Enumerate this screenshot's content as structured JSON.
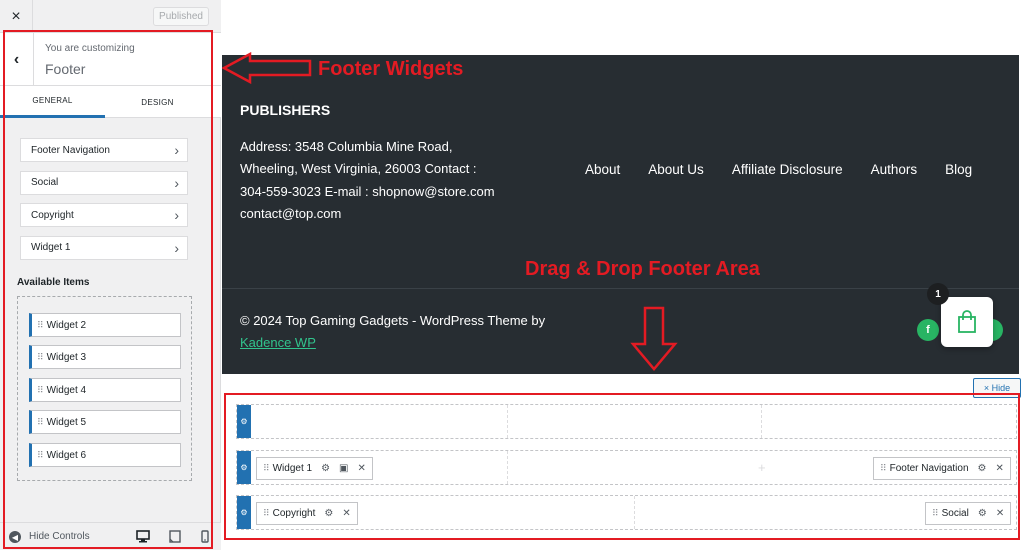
{
  "sidebar": {
    "close_glyph": "×",
    "published_label": "Published",
    "back_glyph": "‹",
    "customizing_label": "You are customizing",
    "section_title": "Footer",
    "tabs": [
      {
        "label": "GENERAL",
        "active": true
      },
      {
        "label": "DESIGN",
        "active": false
      }
    ],
    "nav_items": [
      "Footer Navigation",
      "Social",
      "Copyright",
      "Widget 1"
    ],
    "chevron_glyph": "›",
    "available_label": "Available Items",
    "available_items": [
      "Widget 2",
      "Widget 3",
      "Widget 4",
      "Widget 5",
      "Widget 6"
    ],
    "grip_glyph": "⠿",
    "hide_controls_label": "Hide Controls",
    "device_icons": [
      "desktop-icon",
      "tablet-icon",
      "mobile-icon"
    ]
  },
  "preview": {
    "publishers_title": "PUBLISHERS",
    "address_text": "Address: 3548 Columbia Mine Road, Wheeling, West Virginia, 26003 Contact : 304-559-3023 E-mail : shopnow@store.com contact@top.com",
    "footer_nav": [
      "About",
      "About Us",
      "Affiliate Disclosure",
      "Authors",
      "Blog"
    ],
    "copyright_text": "© 2024 Top Gaming Gadgets - WordPress Theme by",
    "copyright_link": "Kadence WP",
    "cart_count": "1",
    "facebook_glyph": "f",
    "colors": {
      "footer_bg": "#272d32",
      "accent": "#2271b1",
      "link": "#31c48d",
      "social": "#28b463",
      "annotation": "#e31b23"
    }
  },
  "builder": {
    "hide_label": "× Hide",
    "gear_glyph": "⚙",
    "plus_glyph": "+",
    "rows": [
      {
        "chips_left": [],
        "chips_right": []
      },
      {
        "chip_left": "Widget 1",
        "chip_right": "Footer Navigation"
      },
      {
        "chip_left": "Copyright",
        "chip_right": "Social"
      }
    ],
    "chip_actions": {
      "gear": "⚙",
      "box": "▣",
      "remove": "✕"
    }
  },
  "annotations": {
    "footer_widgets": "Footer Widgets",
    "drag_drop": "Drag & Drop Footer Area"
  }
}
